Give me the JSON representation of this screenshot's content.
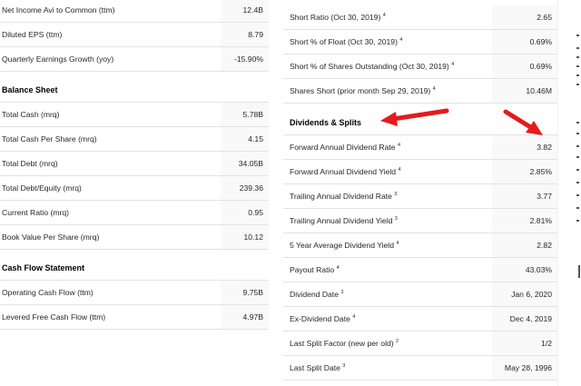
{
  "left": {
    "top_rows": [
      {
        "label": "Net Income Avi to Common (ttm)",
        "value": "12.4B"
      },
      {
        "label": "Diluted EPS (ttm)",
        "value": "8.79"
      },
      {
        "label": "Quarterly Earnings Growth (yoy)",
        "value": "-15.90%"
      }
    ],
    "balance_sheet": {
      "title": "Balance Sheet",
      "rows": [
        {
          "label": "Total Cash (mrq)",
          "value": "5.78B"
        },
        {
          "label": "Total Cash Per Share (mrq)",
          "value": "4.15"
        },
        {
          "label": "Total Debt (mrq)",
          "value": "34.05B"
        },
        {
          "label": "Total Debt/Equity (mrq)",
          "value": "239.36"
        },
        {
          "label": "Current Ratio (mrq)",
          "value": "0.95"
        },
        {
          "label": "Book Value Per Share (mrq)",
          "value": "10.12"
        }
      ]
    },
    "cash_flow": {
      "title": "Cash Flow Statement",
      "rows": [
        {
          "label": "Operating Cash Flow (ttm)",
          "value": "9.75B"
        },
        {
          "label": "Levered Free Cash Flow (ttm)",
          "value": "4.97B"
        }
      ]
    }
  },
  "right": {
    "top_rows": [
      {
        "label": "Short Ratio (Oct 30, 2019)",
        "sup": "4",
        "value": "2.65"
      },
      {
        "label": "Short % of Float (Oct 30, 2019)",
        "sup": "4",
        "value": "0.69%"
      },
      {
        "label": "Short % of Shares Outstanding (Oct 30, 2019)",
        "sup": "4",
        "value": "0.69%"
      },
      {
        "label": "Shares Short (prior month Sep 29, 2019)",
        "sup": "4",
        "value": "10.46M"
      }
    ],
    "dividends": {
      "title": "Dividends & Splits",
      "rows": [
        {
          "label": "Forward Annual Dividend Rate",
          "sup": "4",
          "value": "3.82"
        },
        {
          "label": "Forward Annual Dividend Yield",
          "sup": "4",
          "value": "2.85%"
        },
        {
          "label": "Trailing Annual Dividend Rate",
          "sup": "3",
          "value": "3.77"
        },
        {
          "label": "Trailing Annual Dividend Yield",
          "sup": "3",
          "value": "2.81%"
        },
        {
          "label": "5 Year Average Dividend Yield",
          "sup": "4",
          "value": "2.82"
        },
        {
          "label": "Payout Ratio",
          "sup": "4",
          "value": "43.03%"
        },
        {
          "label": "Dividend Date",
          "sup": "3",
          "value": "Jan 6, 2020"
        },
        {
          "label": "Ex-Dividend Date",
          "sup": "4",
          "value": "Dec 4, 2019"
        },
        {
          "label": "Last Split Factor (new per old)",
          "sup": "2",
          "value": "1/2"
        },
        {
          "label": "Last Split Date",
          "sup": "3",
          "value": "May 28, 1996"
        }
      ]
    }
  },
  "colors": {
    "annotation_arrow": "#e41b1b",
    "divider": "#e3e3e3",
    "value_background": "#f9f9f9"
  }
}
